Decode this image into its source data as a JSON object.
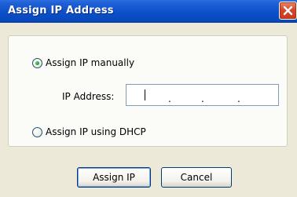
{
  "window": {
    "title": "Assign IP Address",
    "close_icon": "close-icon"
  },
  "options": {
    "manual_label": "Assign IP manually",
    "manual_selected": true,
    "dhcp_label": "Assign IP using DHCP",
    "dhcp_selected": false
  },
  "ip": {
    "label": "IP Address:",
    "value": "",
    "separator": "."
  },
  "buttons": {
    "assign_label": "Assign IP",
    "cancel_label": "Cancel"
  },
  "colors": {
    "titlebar": "#0a4fc9",
    "close": "#d9452c",
    "face": "#ece9d8"
  }
}
